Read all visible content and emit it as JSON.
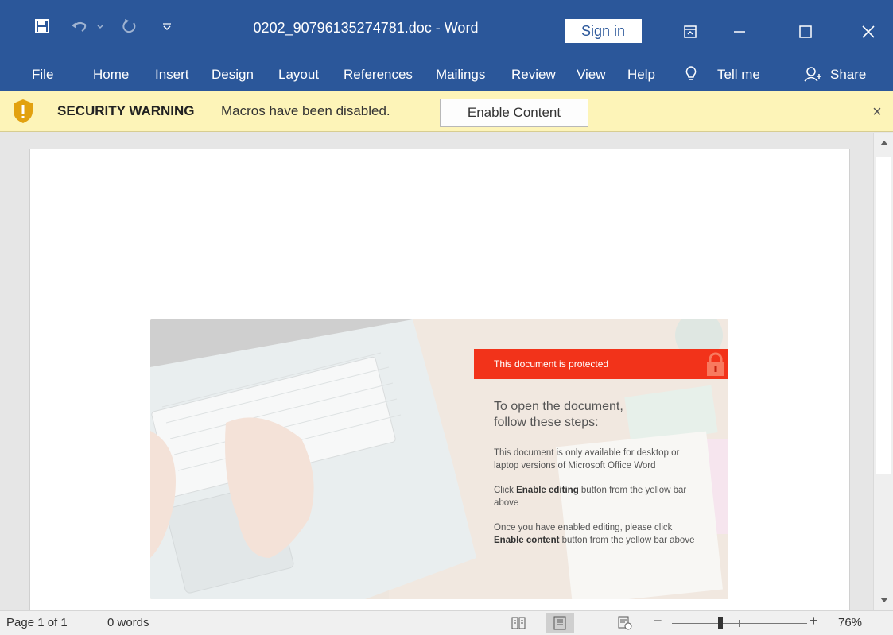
{
  "window": {
    "title": "0202_90796135274781.doc - Word",
    "sign_in": "Sign in",
    "accent": "#2b579a"
  },
  "quick_access": {
    "save_icon": "save-icon",
    "undo_icon": "undo-icon",
    "redo_icon": "redo-icon",
    "customize_icon": "customize-qat-icon"
  },
  "ribbon": {
    "tabs": [
      "File",
      "Home",
      "Insert",
      "Design",
      "Layout",
      "References",
      "Mailings",
      "Review",
      "View",
      "Help"
    ],
    "tell_me": "Tell me",
    "share": "Share"
  },
  "security_bar": {
    "title": "SECURITY WARNING",
    "message": "Macros have been disabled.",
    "button": "Enable Content",
    "close": "×",
    "background": "#fdf4b8"
  },
  "lure": {
    "banner": "This document is protected",
    "banner_color": "#f2331a",
    "heading": "To open the document,\nfollow these steps:",
    "step1": "This document is only available for desktop or laptop versions of Microsoft Office Word",
    "step2_pre": "Click ",
    "step2_bold": "Enable editing",
    "step2_post": " button from the yellow bar above",
    "step3_pre": "Once you have enabled editing, please click ",
    "step3_bold": "Enable content",
    "step3_post": " button from the yellow bar above"
  },
  "status_bar": {
    "page": "Page 1 of 1",
    "words": "0 words",
    "zoom_minus": "−",
    "zoom_plus": "+",
    "zoom": "76%",
    "zoom_level": 0.76
  }
}
